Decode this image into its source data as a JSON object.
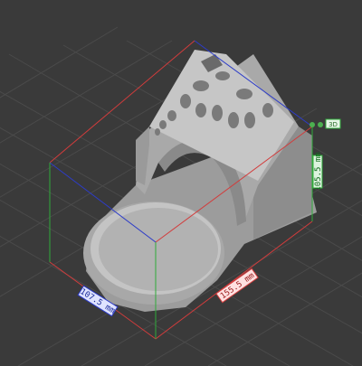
{
  "viewport": {
    "background": "#3a3a3a",
    "grid_color": "#4a4a4a",
    "model_color": "#b9b9b9"
  },
  "dimensions": {
    "width_label": "107.5 mm",
    "depth_label": "155.5 mm",
    "height_label": "105.5 mm",
    "x_color": "#d23c3c",
    "y_color": "#2d3cc8",
    "z_color": "#2faa3a"
  },
  "gizmo": {
    "label": "3D"
  }
}
